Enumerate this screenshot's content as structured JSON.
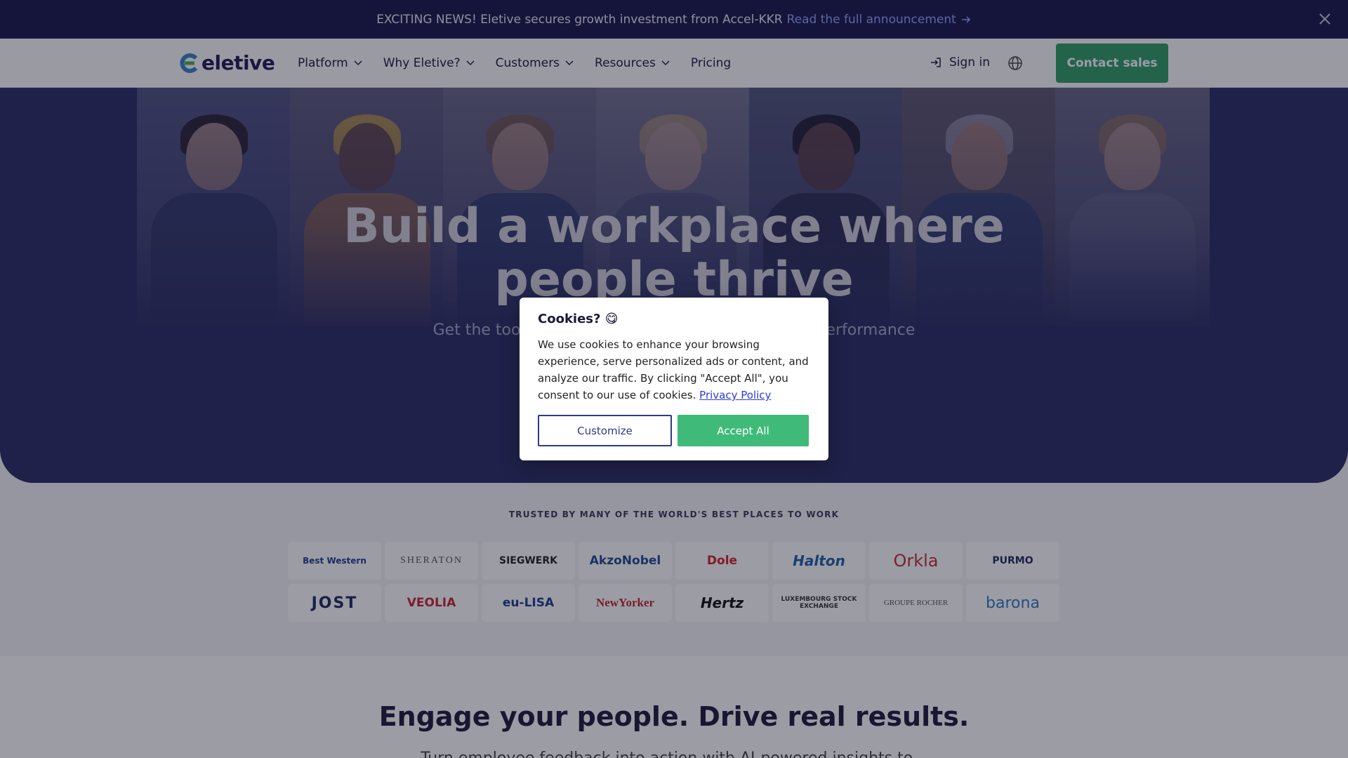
{
  "announcement": {
    "text": "EXCITING NEWS! Eletive secures growth investment from Accel-KKR",
    "link": "Read the full announcement"
  },
  "nav": {
    "logo": "eletive",
    "items": [
      {
        "label": "Platform",
        "dropdown": true
      },
      {
        "label": "Why Eletive?",
        "dropdown": true
      },
      {
        "label": "Customers",
        "dropdown": true
      },
      {
        "label": "Resources",
        "dropdown": true
      },
      {
        "label": "Pricing",
        "dropdown": false
      }
    ],
    "signin": "Sign in",
    "contact": "Contact sales"
  },
  "hero": {
    "title_line1": "Build a workplace where",
    "title_line2": "people thrive",
    "subtitle": "Get the tools you need to drive engagement and performance"
  },
  "trusted": {
    "label": "TRUSTED BY MANY OF THE WORLD'S BEST PLACES TO WORK",
    "logos": [
      {
        "name": "Best Western",
        "color": "#1b3f8c"
      },
      {
        "name": "SHERATON",
        "color": "#555555"
      },
      {
        "name": "SIEGWERK",
        "color": "#222222"
      },
      {
        "name": "AkzoNobel",
        "color": "#1e4a8c"
      },
      {
        "name": "Dole",
        "color": "#d12027"
      },
      {
        "name": "Halton",
        "color": "#1f5fa8"
      },
      {
        "name": "Orkla",
        "color": "#c4302b"
      },
      {
        "name": "PURMO",
        "color": "#1d2b5a"
      },
      {
        "name": "JOST",
        "color": "#1d2b5a"
      },
      {
        "name": "VEOLIA",
        "color": "#c4262e"
      },
      {
        "name": "eu-LISA",
        "color": "#1d3d8a"
      },
      {
        "name": "NewYorker",
        "color": "#c4262e"
      },
      {
        "name": "Hertz",
        "color": "#111111"
      },
      {
        "name": "LUXEMBOURG STOCK EXCHANGE",
        "color": "#333333"
      },
      {
        "name": "GROUPE ROCHER",
        "color": "#555555"
      },
      {
        "name": "barona",
        "color": "#2d7bbd"
      }
    ]
  },
  "lower": {
    "title": "Engage your people. Drive real results.",
    "subtitle": "Turn employee feedback into action with AI-powered insights to..."
  },
  "cookie": {
    "title": "Cookies? 😋",
    "body": "We use cookies to enhance your browsing experience, serve personalized ads or content, and analyze our traffic. By clicking \"Accept All\", you consent to our use of cookies.",
    "link": "Privacy Policy",
    "customize": "Customize",
    "accept": "Accept All"
  },
  "colors": {
    "announce_bg": "#18184a",
    "hero_bg": "#2a2c62",
    "accent_green": "#2f9e63",
    "accept_green": "#3fba78"
  }
}
